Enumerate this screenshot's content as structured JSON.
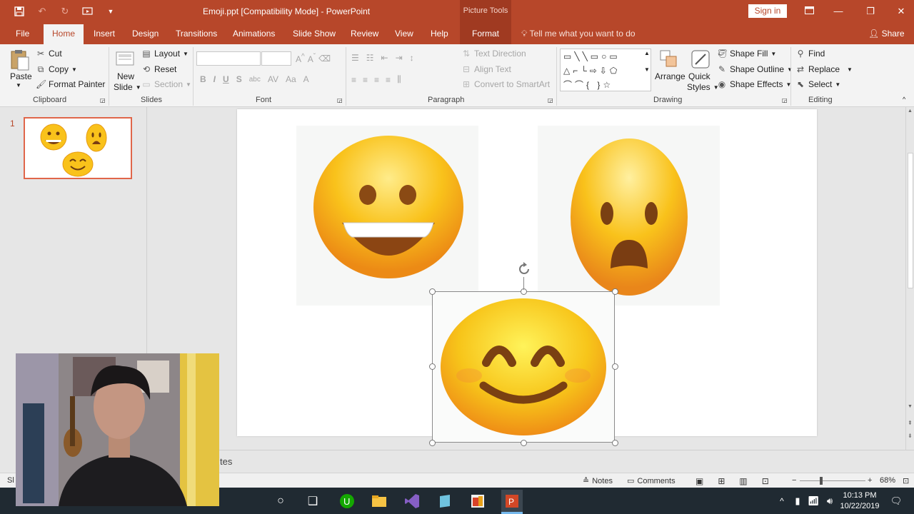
{
  "window": {
    "doc_title": "Emoji.ppt [Compatibility Mode]  -  PowerPoint",
    "picture_tools": "Picture Tools",
    "signin": "Sign in"
  },
  "tabs": [
    "File",
    "Home",
    "Insert",
    "Design",
    "Transitions",
    "Animations",
    "Slide Show",
    "Review",
    "View",
    "Help"
  ],
  "format_tab": "Format",
  "tellme": "Tell me what you want to do",
  "share": "Share",
  "ribbon": {
    "clipboard": {
      "paste": "Paste",
      "cut": "Cut",
      "copy": "Copy",
      "format_painter": "Format Painter",
      "label": "Clipboard"
    },
    "slides": {
      "new_slide_1": "New",
      "new_slide_2": "Slide",
      "layout": "Layout",
      "reset": "Reset",
      "section": "Section",
      "label": "Slides"
    },
    "font": {
      "label": "Font"
    },
    "paragraph": {
      "text_direction": "Text Direction",
      "align_text": "Align Text",
      "convert_smartart": "Convert to SmartArt",
      "label": "Paragraph"
    },
    "drawing": {
      "arrange": "Arrange",
      "quick_styles_1": "Quick",
      "quick_styles_2": "Styles",
      "shape_fill": "Shape Fill",
      "shape_outline": "Shape Outline",
      "shape_effects": "Shape Effects",
      "label": "Drawing"
    },
    "editing": {
      "find": "Find",
      "replace": "Replace",
      "select": "Select",
      "label": "Editing"
    }
  },
  "thumbnail": {
    "number": "1"
  },
  "notes": {
    "text": "tes"
  },
  "statusbar": {
    "left": "Sl",
    "notes": "Notes",
    "comments": "Comments",
    "zoom": "68%"
  },
  "taskbar": {
    "time": "10:13 PM",
    "date": "10/22/2019"
  },
  "colors": {
    "accent": "#b7472a",
    "emoji_yellow": "#f9c21b"
  }
}
